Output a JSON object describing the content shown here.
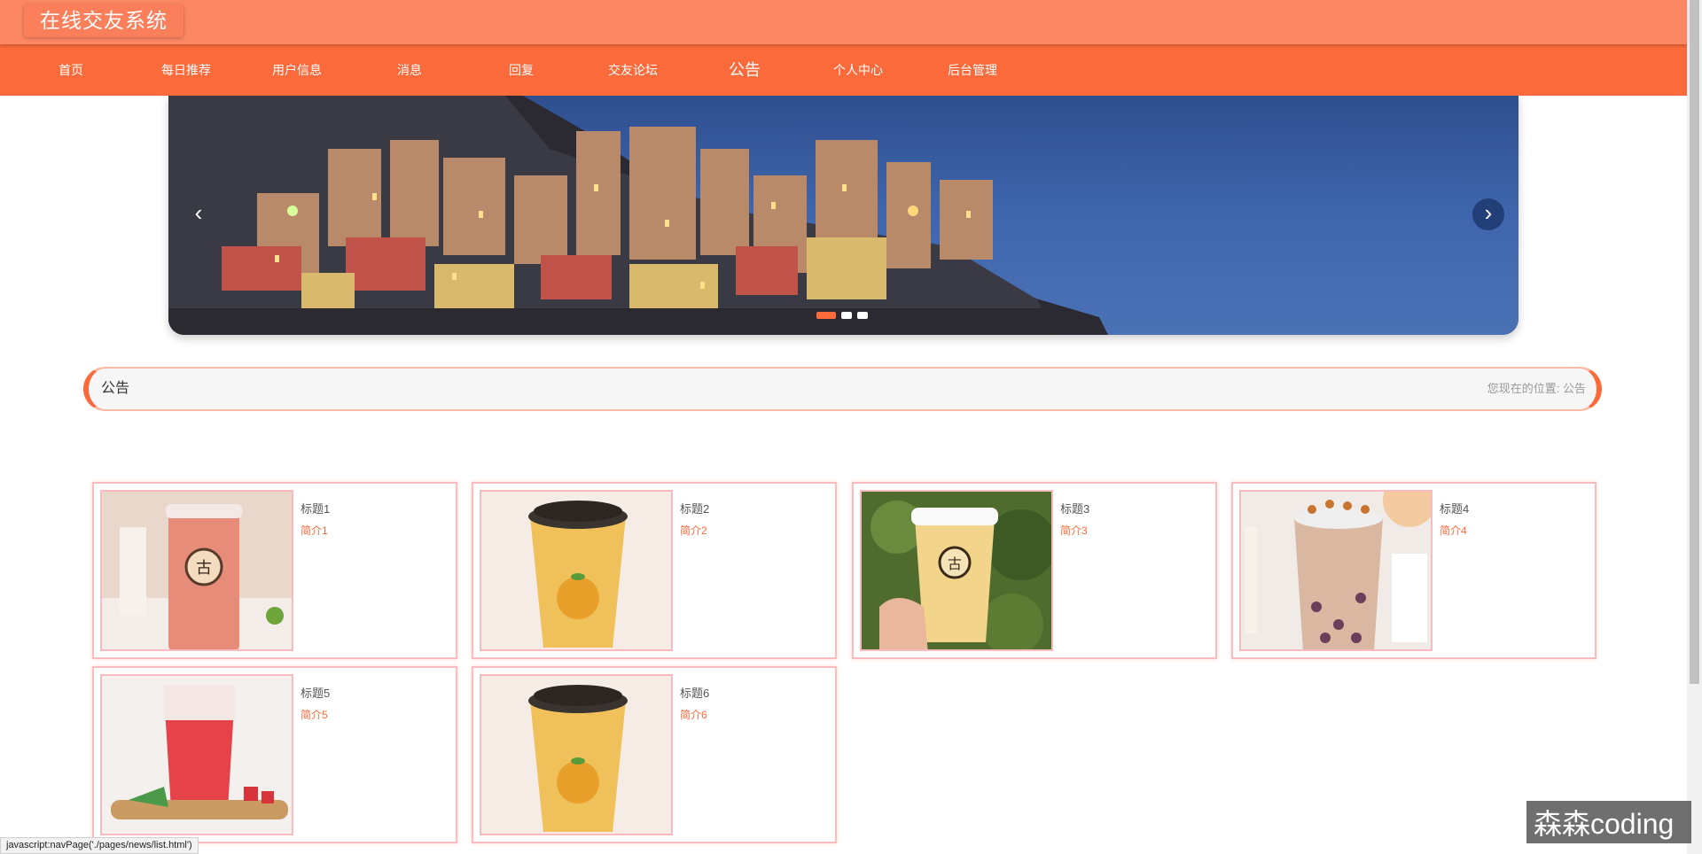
{
  "app": {
    "title": "在线交友系统"
  },
  "nav": {
    "items": [
      {
        "label": "首页"
      },
      {
        "label": "每日推荐"
      },
      {
        "label": "用户信息"
      },
      {
        "label": "消息"
      },
      {
        "label": "回复"
      },
      {
        "label": "交友论坛"
      },
      {
        "label": "公告"
      },
      {
        "label": "个人中心"
      },
      {
        "label": "后台管理"
      }
    ],
    "active_index": 6
  },
  "banner": {
    "prev_icon": "chevron-left-icon",
    "next_icon": "chevron-right-icon",
    "prev_symbol": "‹",
    "next_symbol": "›",
    "slide_count": 3,
    "active_slide": 0
  },
  "breadcrumb": {
    "title": "公告",
    "location_label": "您现在的位置:",
    "current": "公告"
  },
  "cards": [
    {
      "title": "标题1",
      "intro": "简介1",
      "image": "fruit-tea-cup"
    },
    {
      "title": "标题2",
      "intro": "简介2",
      "image": "boba-milk-tea-cup"
    },
    {
      "title": "标题3",
      "intro": "简介3",
      "image": "hand-held-drink"
    },
    {
      "title": "标题4",
      "intro": "简介4",
      "image": "taro-milk-tea-poster"
    },
    {
      "title": "标题5",
      "intro": "简介5",
      "image": "watermelon-drink"
    },
    {
      "title": "标题6",
      "intro": "简介6",
      "image": "boba-milk-tea-cup"
    }
  ],
  "status_bar": {
    "text": "javascript:navPage('./pages/news/list.html')"
  },
  "watermark": {
    "text": "森森coding"
  },
  "colors": {
    "primary": "#fa6a3b",
    "header": "#fb8762",
    "card_border": "#fbb9c0"
  }
}
